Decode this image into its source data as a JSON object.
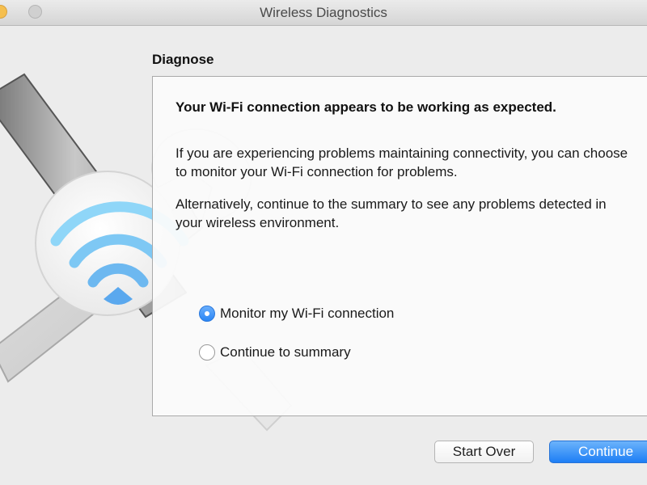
{
  "window": {
    "title": "Wireless Diagnostics"
  },
  "section": {
    "title": "Diagnose"
  },
  "panel": {
    "headline": "Your Wi-Fi connection appears to be working as expected.",
    "paragraph1": "If you are experiencing problems maintaining connectivity, you can choose to monitor your Wi-Fi connection for problems.",
    "paragraph2": "Alternatively, continue to the summary to see any problems detected in your wireless environment."
  },
  "options": [
    {
      "label": "Monitor my Wi-Fi connection",
      "selected": true
    },
    {
      "label": "Continue to summary",
      "selected": false
    }
  ],
  "buttons": {
    "start_over": "Start Over",
    "continue": "Continue"
  },
  "colors": {
    "accent": "#2a86f5",
    "wifi_icon": "#7fcdf6"
  },
  "icons": [
    "wifi-icon",
    "tools-icon"
  ]
}
